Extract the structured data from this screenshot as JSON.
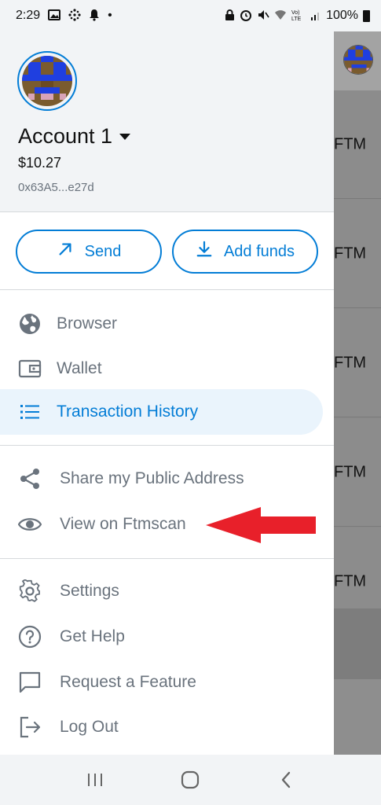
{
  "status_bar": {
    "time": "2:29",
    "battery": "100%",
    "dot": "•"
  },
  "account": {
    "name": "Account 1",
    "balance": "$10.27",
    "address": "0x63A5...e27d"
  },
  "actions": {
    "send_label": "Send",
    "add_funds_label": "Add funds"
  },
  "menu": {
    "section1": [
      {
        "label": "Browser",
        "icon": "globe-icon"
      },
      {
        "label": "Wallet",
        "icon": "wallet-icon"
      },
      {
        "label": "Transaction History",
        "icon": "list-icon",
        "active": true
      }
    ],
    "section2": [
      {
        "label": "Share my Public Address",
        "icon": "share-icon"
      },
      {
        "label": "View on Ftmscan",
        "icon": "eye-icon"
      }
    ],
    "section3": [
      {
        "label": "Settings",
        "icon": "gear-icon"
      },
      {
        "label": "Get Help",
        "icon": "help-icon"
      },
      {
        "label": "Request a Feature",
        "icon": "chat-icon"
      },
      {
        "label": "Log Out",
        "icon": "logout-icon"
      }
    ]
  },
  "background_rows": [
    "FTM",
    "FTM",
    "FTM",
    "FTM",
    "FTM"
  ],
  "colors": {
    "accent": "#037dd6",
    "annotation_arrow": "#e8202a"
  }
}
